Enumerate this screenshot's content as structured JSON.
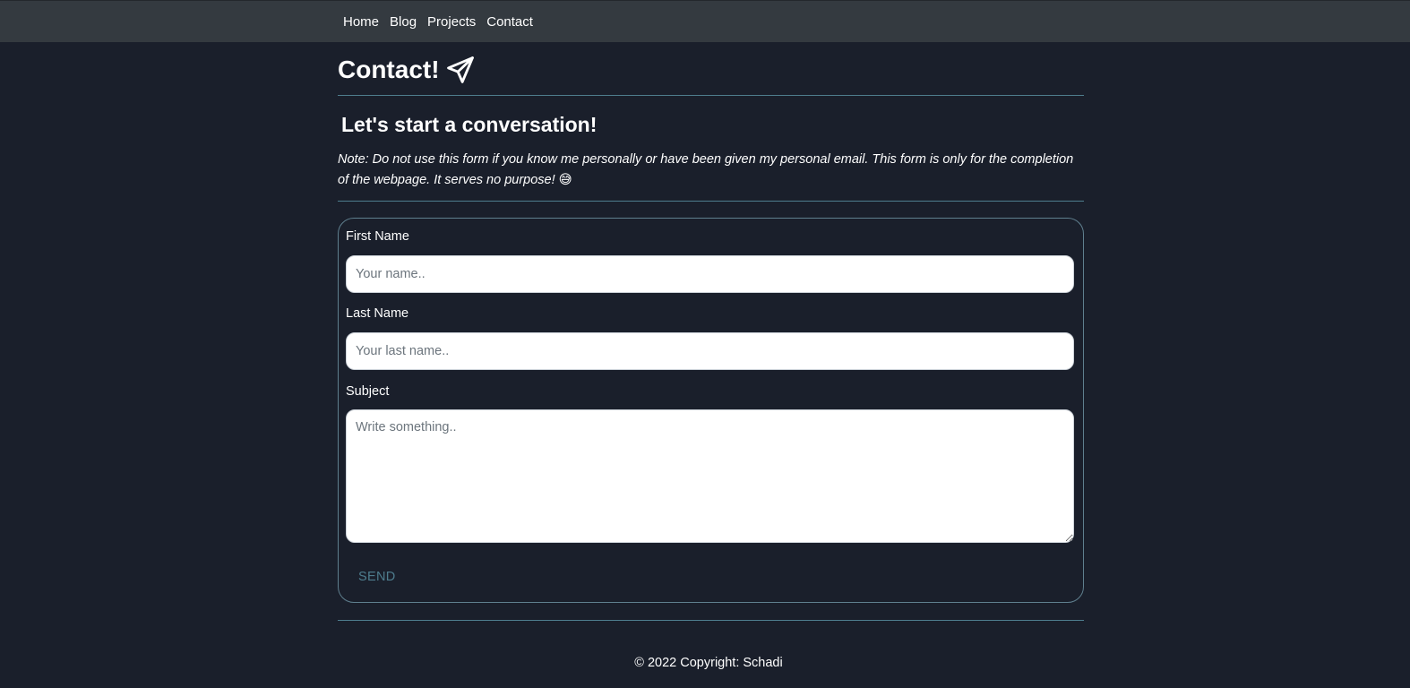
{
  "nav": {
    "links": [
      "Home",
      "Blog",
      "Projects",
      "Contact"
    ]
  },
  "page": {
    "title": "Contact!",
    "title_icon": "paper-plane-icon",
    "subtitle": "Let's start a conversation!",
    "note": "Note: Do not use this form if you know me personally or have been given my personal email. This form is only for the completion of the webpage. It serves no purpose! 😅"
  },
  "form": {
    "first_name": {
      "label": "First Name",
      "placeholder": "Your name..",
      "value": ""
    },
    "last_name": {
      "label": "Last Name",
      "placeholder": "Your last name..",
      "value": ""
    },
    "subject": {
      "label": "Subject",
      "placeholder": "Write something..",
      "value": ""
    },
    "send_label": "SEND"
  },
  "footer": {
    "copyright": "© 2022 Copyright: Schadi"
  },
  "colors": {
    "background": "#1a1f2b",
    "navbar": "#343a40",
    "accent": "#4e7d8e",
    "text": "#ffffff"
  }
}
